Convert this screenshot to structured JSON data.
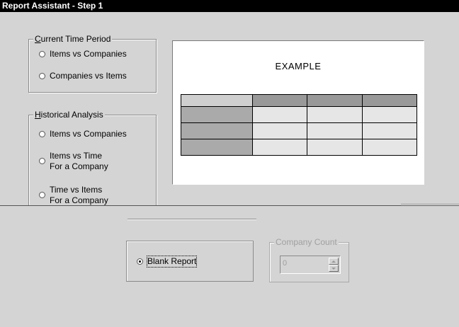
{
  "window": {
    "title": "Report Assistant - Step 1"
  },
  "current_time_period": {
    "legend_prefix": "",
    "legend_accel": "C",
    "legend_rest": "urrent Time Period",
    "options": [
      "Items vs Companies",
      "Companies vs Items"
    ]
  },
  "historical_analysis": {
    "legend_accel": "H",
    "legend_rest": "istorical Analysis",
    "options": [
      {
        "line1": "Items vs Companies",
        "line2": ""
      },
      {
        "line1": "Items vs Time",
        "line2": "For a Company"
      },
      {
        "line1": "Time vs Items",
        "line2": "For a Company"
      }
    ]
  },
  "example": {
    "title": "EXAMPLE"
  },
  "bottom": {
    "blank_report_label": "Blank Report",
    "blank_report_checked": true,
    "company_count_legend": "Company Count",
    "company_count_value": "0"
  }
}
